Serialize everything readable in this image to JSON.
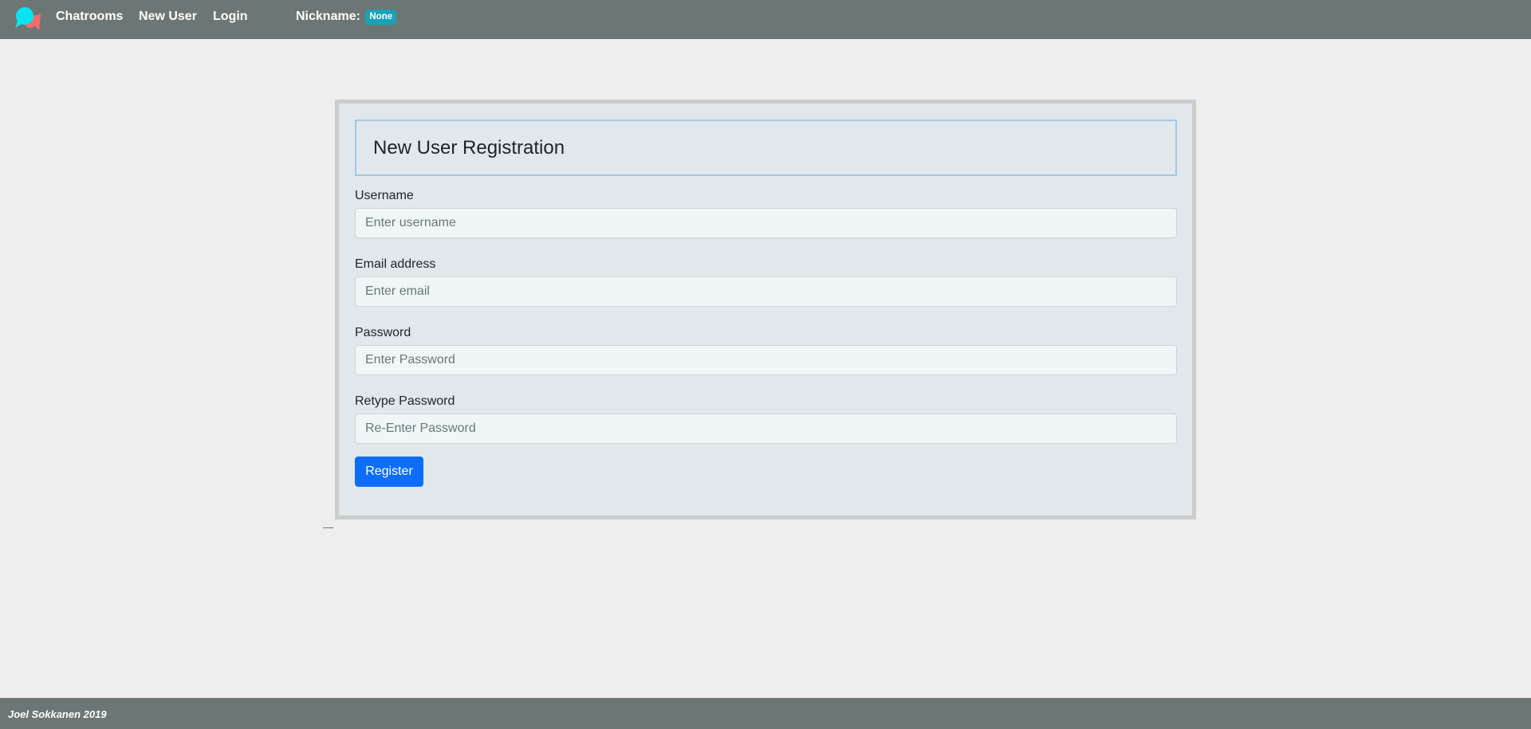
{
  "nav": {
    "logo_icon": "chat-bubbles-icon",
    "links": {
      "chatrooms": "Chatrooms",
      "new_user": "New User",
      "login": "Login"
    },
    "nickname_label": "Nickname:",
    "nickname_value": "None"
  },
  "form": {
    "title": "New User Registration",
    "fields": {
      "username": {
        "label": "Username",
        "placeholder": "Enter username"
      },
      "email": {
        "label": "Email address",
        "placeholder": "Enter email"
      },
      "password": {
        "label": "Password",
        "placeholder": "Enter Password"
      },
      "retype": {
        "label": "Retype Password",
        "placeholder": "Re-Enter Password"
      }
    },
    "submit_label": "Register"
  },
  "footer": {
    "text": "Joel Sokkanen 2019"
  },
  "colors": {
    "navbar": "#6c7775",
    "badge": "#17a2b8",
    "button": "#0d6efd",
    "card": "#e1e7ea",
    "logo_primary": "#00e5f0",
    "logo_secondary": "#ef6f6f"
  }
}
